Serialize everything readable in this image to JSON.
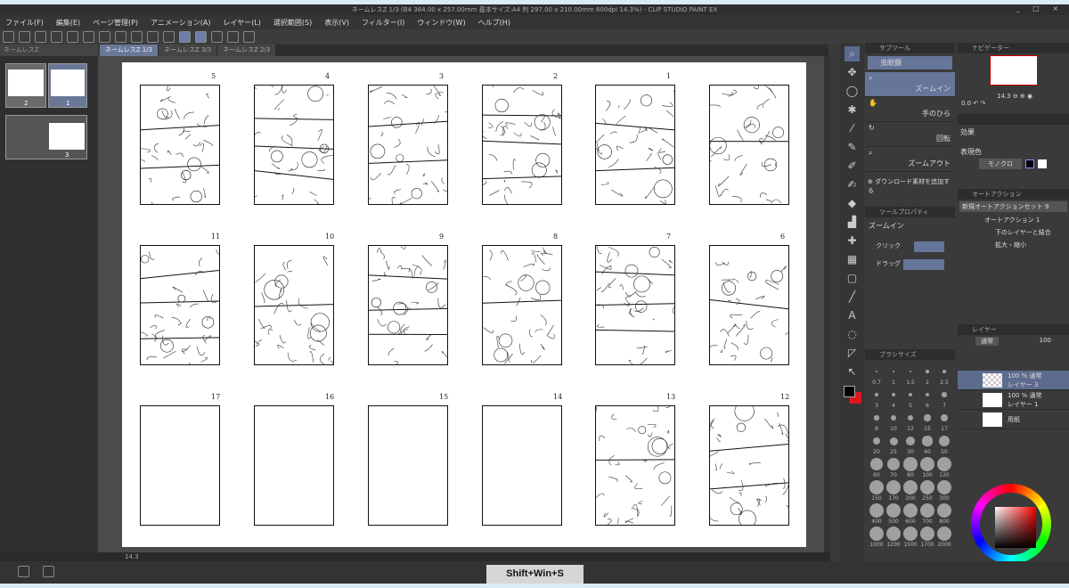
{
  "window": {
    "title": "ネームレスZ 1/3 (B4 364.00 x 257.00mm 基本サイズ:A4 判 297.00 x 210.00mm 600dpi 14.3%) - CLIP STUDIO PAINT EX",
    "controls": "_ □ ×"
  },
  "menu": [
    "ファイル(F)",
    "編集(E)",
    "ページ管理(P)",
    "アニメーション(A)",
    "レイヤー(L)",
    "選択範囲(S)",
    "表示(V)",
    "フィルター(I)",
    "ウィンドウ(W)",
    "ヘルプ(H)"
  ],
  "left_panel": {
    "tab": "ネームレスZ",
    "pages": [
      "2",
      "1",
      "3"
    ]
  },
  "tabs": [
    {
      "label": "ネームレスZ 1/3",
      "active": true
    },
    {
      "label": "ネームレスZ 3/3",
      "active": false
    },
    {
      "label": "ネームレスZ 2/3",
      "active": false
    }
  ],
  "canvas": {
    "rows": [
      [
        {
          "num": "5",
          "filled": true
        },
        {
          "num": "4",
          "filled": true
        },
        {
          "num": "3",
          "filled": true
        },
        {
          "num": "2",
          "filled": true
        },
        {
          "num": "1",
          "filled": true
        },
        {
          "num": "",
          "filled": true
        }
      ],
      [
        {
          "num": "11",
          "filled": true
        },
        {
          "num": "10",
          "filled": true
        },
        {
          "num": "9",
          "filled": true
        },
        {
          "num": "8",
          "filled": true
        },
        {
          "num": "7",
          "filled": true
        },
        {
          "num": "6",
          "filled": true
        }
      ],
      [
        {
          "num": "17",
          "filled": false
        },
        {
          "num": "16",
          "filled": false
        },
        {
          "num": "15",
          "filled": false
        },
        {
          "num": "14",
          "filled": false
        },
        {
          "num": "13",
          "filled": true
        },
        {
          "num": "12",
          "filled": true
        }
      ]
    ]
  },
  "status": {
    "zoom": "14.3"
  },
  "subtool": {
    "tab": "サブツール",
    "group": "虫眼鏡",
    "items": [
      "ズームイン",
      "手のひら",
      "回転",
      "ズームアウト"
    ],
    "add": "ダウンロード素材を追加する"
  },
  "tool_property": {
    "tab": "ツールプロパティ",
    "title": "ズームイン",
    "click": "クリック",
    "drag": "ドラッグ"
  },
  "brush_size": {
    "tab": "ブラシサイズ",
    "sizes": [
      "0.7",
      "1",
      "1.5",
      "2",
      "2.5",
      "3",
      "4",
      "5",
      "6",
      "7",
      "8",
      "10",
      "12",
      "15",
      "17",
      "20",
      "25",
      "30",
      "40",
      "50",
      "60",
      "70",
      "80",
      "100",
      "120",
      "150",
      "170",
      "200",
      "250",
      "300",
      "400",
      "500",
      "600",
      "700",
      "800",
      "1000",
      "1200",
      "1500",
      "1700",
      "2000"
    ]
  },
  "navigator": {
    "tab": "ナビゲーター",
    "zoom": "14.3",
    "angle": "0.0"
  },
  "layer_property": {
    "effect": "効果",
    "expression_color": "表現色",
    "color_mode": "モノクロ"
  },
  "auto_action": {
    "tab": "オートアクション",
    "set": "新規オートアクションセット 9",
    "items": [
      "オートアクション 1",
      "下のレイヤーと結合",
      "拡大・縮小"
    ]
  },
  "layers": {
    "tab": "レイヤー",
    "blend": "通常",
    "opacity": "100",
    "items": [
      {
        "line1": "100 % 通常",
        "line2": "レイヤー 3",
        "active": true
      },
      {
        "line1": "100 % 通常",
        "line2": "レイヤー 1",
        "active": false
      },
      {
        "line1": "",
        "line2": "用紙",
        "active": false
      }
    ]
  },
  "colors": {
    "main": "#000000",
    "sub": "#e0161b",
    "accent": "#6a7898"
  },
  "shortcut_overlay": "Shift+Win+S"
}
